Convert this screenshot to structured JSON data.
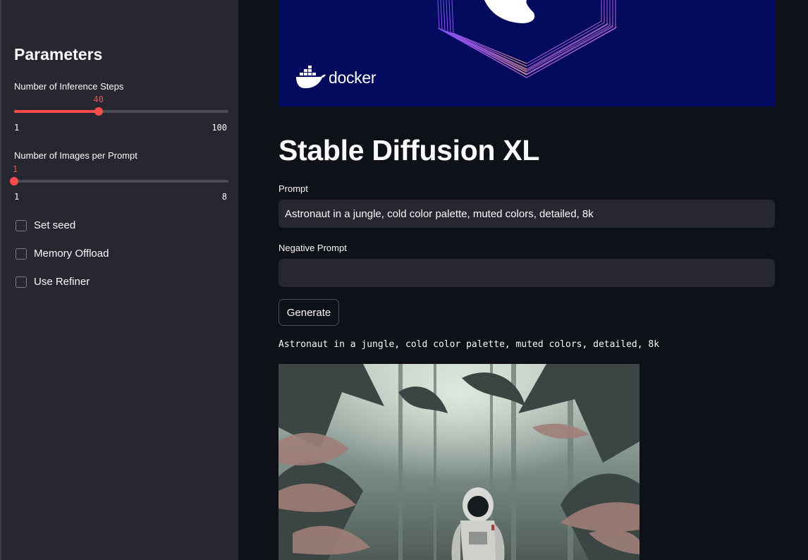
{
  "sidebar": {
    "title": "Parameters",
    "inference_steps": {
      "label": "Number of Inference Steps",
      "value": "40",
      "min": "1",
      "max": "100",
      "fraction": 0.394
    },
    "images_per_prompt": {
      "label": "Number of Images per Prompt",
      "value": "1",
      "min": "1",
      "max": "8",
      "fraction": 0.0
    },
    "checkboxes": [
      {
        "label": "Set seed",
        "checked": false
      },
      {
        "label": "Memory Offload",
        "checked": false
      },
      {
        "label": "Use Refiner",
        "checked": false
      }
    ]
  },
  "main": {
    "banner": {
      "brand": "docker"
    },
    "title": "Stable Diffusion XL",
    "prompt": {
      "label": "Prompt",
      "value": "Astronaut in a jungle, cold color palette, muted colors, detailed, 8k"
    },
    "negative_prompt": {
      "label": "Negative Prompt",
      "value": ""
    },
    "generate_label": "Generate",
    "output_caption": "Astronaut in a jungle, cold color palette, muted colors, detailed, 8k"
  },
  "colors": {
    "accent": "#ff4b4b",
    "sidebar_bg": "#262730",
    "main_bg": "#0e1117",
    "banner_bg": "#020a5e"
  }
}
